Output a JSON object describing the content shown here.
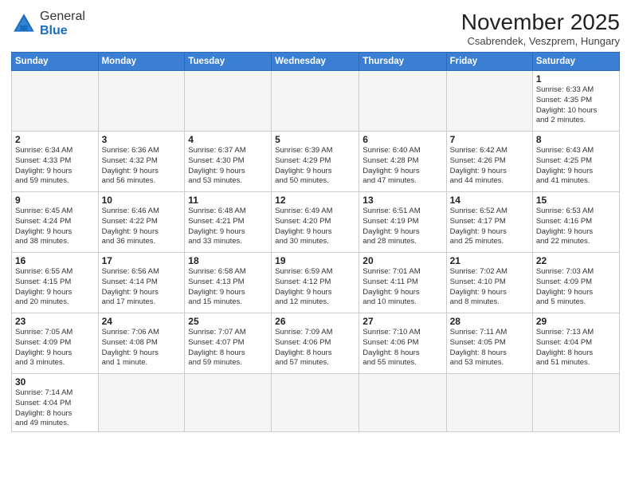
{
  "logo": {
    "general": "General",
    "blue": "Blue"
  },
  "header": {
    "month": "November 2025",
    "location": "Csabrendek, Veszprem, Hungary"
  },
  "weekdays": [
    "Sunday",
    "Monday",
    "Tuesday",
    "Wednesday",
    "Thursday",
    "Friday",
    "Saturday"
  ],
  "weeks": [
    [
      {
        "day": "",
        "info": ""
      },
      {
        "day": "",
        "info": ""
      },
      {
        "day": "",
        "info": ""
      },
      {
        "day": "",
        "info": ""
      },
      {
        "day": "",
        "info": ""
      },
      {
        "day": "",
        "info": ""
      },
      {
        "day": "1",
        "info": "Sunrise: 6:33 AM\nSunset: 4:35 PM\nDaylight: 10 hours\nand 2 minutes."
      }
    ],
    [
      {
        "day": "2",
        "info": "Sunrise: 6:34 AM\nSunset: 4:33 PM\nDaylight: 9 hours\nand 59 minutes."
      },
      {
        "day": "3",
        "info": "Sunrise: 6:36 AM\nSunset: 4:32 PM\nDaylight: 9 hours\nand 56 minutes."
      },
      {
        "day": "4",
        "info": "Sunrise: 6:37 AM\nSunset: 4:30 PM\nDaylight: 9 hours\nand 53 minutes."
      },
      {
        "day": "5",
        "info": "Sunrise: 6:39 AM\nSunset: 4:29 PM\nDaylight: 9 hours\nand 50 minutes."
      },
      {
        "day": "6",
        "info": "Sunrise: 6:40 AM\nSunset: 4:28 PM\nDaylight: 9 hours\nand 47 minutes."
      },
      {
        "day": "7",
        "info": "Sunrise: 6:42 AM\nSunset: 4:26 PM\nDaylight: 9 hours\nand 44 minutes."
      },
      {
        "day": "8",
        "info": "Sunrise: 6:43 AM\nSunset: 4:25 PM\nDaylight: 9 hours\nand 41 minutes."
      }
    ],
    [
      {
        "day": "9",
        "info": "Sunrise: 6:45 AM\nSunset: 4:24 PM\nDaylight: 9 hours\nand 38 minutes."
      },
      {
        "day": "10",
        "info": "Sunrise: 6:46 AM\nSunset: 4:22 PM\nDaylight: 9 hours\nand 36 minutes."
      },
      {
        "day": "11",
        "info": "Sunrise: 6:48 AM\nSunset: 4:21 PM\nDaylight: 9 hours\nand 33 minutes."
      },
      {
        "day": "12",
        "info": "Sunrise: 6:49 AM\nSunset: 4:20 PM\nDaylight: 9 hours\nand 30 minutes."
      },
      {
        "day": "13",
        "info": "Sunrise: 6:51 AM\nSunset: 4:19 PM\nDaylight: 9 hours\nand 28 minutes."
      },
      {
        "day": "14",
        "info": "Sunrise: 6:52 AM\nSunset: 4:17 PM\nDaylight: 9 hours\nand 25 minutes."
      },
      {
        "day": "15",
        "info": "Sunrise: 6:53 AM\nSunset: 4:16 PM\nDaylight: 9 hours\nand 22 minutes."
      }
    ],
    [
      {
        "day": "16",
        "info": "Sunrise: 6:55 AM\nSunset: 4:15 PM\nDaylight: 9 hours\nand 20 minutes."
      },
      {
        "day": "17",
        "info": "Sunrise: 6:56 AM\nSunset: 4:14 PM\nDaylight: 9 hours\nand 17 minutes."
      },
      {
        "day": "18",
        "info": "Sunrise: 6:58 AM\nSunset: 4:13 PM\nDaylight: 9 hours\nand 15 minutes."
      },
      {
        "day": "19",
        "info": "Sunrise: 6:59 AM\nSunset: 4:12 PM\nDaylight: 9 hours\nand 12 minutes."
      },
      {
        "day": "20",
        "info": "Sunrise: 7:01 AM\nSunset: 4:11 PM\nDaylight: 9 hours\nand 10 minutes."
      },
      {
        "day": "21",
        "info": "Sunrise: 7:02 AM\nSunset: 4:10 PM\nDaylight: 9 hours\nand 8 minutes."
      },
      {
        "day": "22",
        "info": "Sunrise: 7:03 AM\nSunset: 4:09 PM\nDaylight: 9 hours\nand 5 minutes."
      }
    ],
    [
      {
        "day": "23",
        "info": "Sunrise: 7:05 AM\nSunset: 4:09 PM\nDaylight: 9 hours\nand 3 minutes."
      },
      {
        "day": "24",
        "info": "Sunrise: 7:06 AM\nSunset: 4:08 PM\nDaylight: 9 hours\nand 1 minute."
      },
      {
        "day": "25",
        "info": "Sunrise: 7:07 AM\nSunset: 4:07 PM\nDaylight: 8 hours\nand 59 minutes."
      },
      {
        "day": "26",
        "info": "Sunrise: 7:09 AM\nSunset: 4:06 PM\nDaylight: 8 hours\nand 57 minutes."
      },
      {
        "day": "27",
        "info": "Sunrise: 7:10 AM\nSunset: 4:06 PM\nDaylight: 8 hours\nand 55 minutes."
      },
      {
        "day": "28",
        "info": "Sunrise: 7:11 AM\nSunset: 4:05 PM\nDaylight: 8 hours\nand 53 minutes."
      },
      {
        "day": "29",
        "info": "Sunrise: 7:13 AM\nSunset: 4:04 PM\nDaylight: 8 hours\nand 51 minutes."
      }
    ],
    [
      {
        "day": "30",
        "info": "Sunrise: 7:14 AM\nSunset: 4:04 PM\nDaylight: 8 hours\nand 49 minutes."
      },
      {
        "day": "",
        "info": ""
      },
      {
        "day": "",
        "info": ""
      },
      {
        "day": "",
        "info": ""
      },
      {
        "day": "",
        "info": ""
      },
      {
        "day": "",
        "info": ""
      },
      {
        "day": "",
        "info": ""
      }
    ]
  ]
}
